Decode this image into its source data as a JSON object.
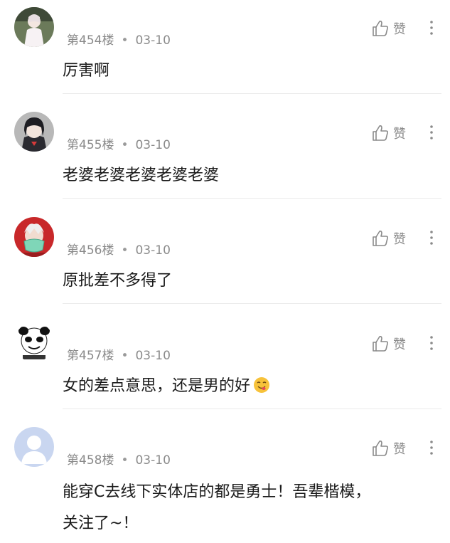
{
  "like_label": "赞",
  "separator_dot": "•",
  "comments": [
    {
      "floor": "第454楼",
      "date": "03-10",
      "text": "厉害啊",
      "avatar": "girl-white-dress-avatar"
    },
    {
      "floor": "第455楼",
      "date": "03-10",
      "text": "老婆老婆老婆老婆老婆",
      "avatar": "anime-boy-avatar"
    },
    {
      "floor": "第456楼",
      "date": "03-10",
      "text": "原批差不多得了",
      "avatar": "masked-character-avatar"
    },
    {
      "floor": "第457楼",
      "date": "03-10",
      "text": "女的差点意思，还是男的好",
      "text_emoji": "yum-face-emoji",
      "avatar": "panda-meme-avatar"
    },
    {
      "floor": "第458楼",
      "date": "03-10",
      "text_line1": "能穿C去线下实体店的都是勇士！吾辈楷模，",
      "text_line2": "关注了~！",
      "avatar": "default-user-avatar"
    }
  ],
  "colors": {
    "meta_gray": "#8a8a8a",
    "text_dark": "#1a1a1a",
    "divider": "#ebebeb",
    "default_avatar_bg": "#c9d6f0"
  }
}
